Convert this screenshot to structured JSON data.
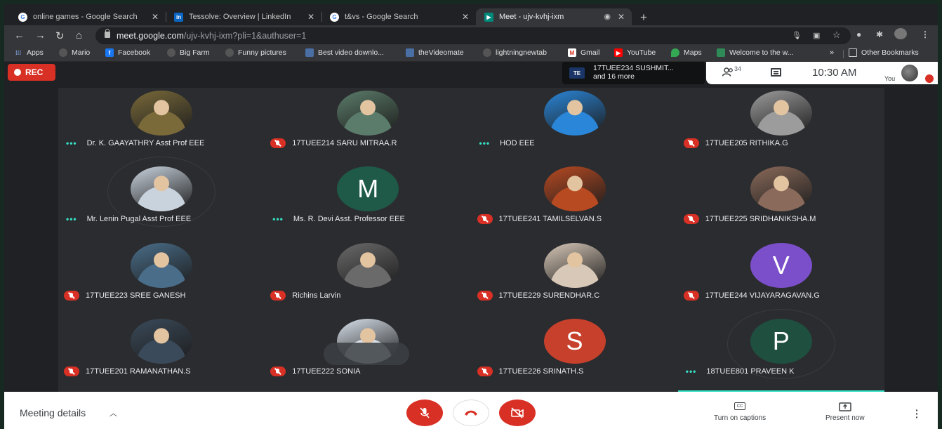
{
  "browser": {
    "tabs": [
      {
        "title": "online games - Google Search",
        "favicon": "google-icon",
        "active": false
      },
      {
        "title": "Tessolve: Overview | LinkedIn",
        "favicon": "linkedin-icon",
        "active": false
      },
      {
        "title": "t&vs - Google Search",
        "favicon": "google-icon",
        "active": false
      },
      {
        "title": "Meet - ujv-kvhj-ixm",
        "favicon": "meet-icon",
        "active": true
      }
    ],
    "url_host": "meet.google.com",
    "url_rest": "/ujv-kvhj-ixm?pli=1&authuser=1",
    "bookmarks": [
      {
        "label": "Apps",
        "icon": "apps-grid-icon"
      },
      {
        "label": "Mario",
        "icon": "globe-icon"
      },
      {
        "label": "Facebook",
        "icon": "facebook-icon"
      },
      {
        "label": "Big Farm",
        "icon": "globe-icon"
      },
      {
        "label": "Funny pictures",
        "icon": "globe-icon"
      },
      {
        "label": "Best video downlo...",
        "icon": "bookmark-icon"
      },
      {
        "label": "theVideomate",
        "icon": "bookmark-icon"
      },
      {
        "label": "lightningnewtab",
        "icon": "globe-icon"
      },
      {
        "label": "Gmail",
        "icon": "gmail-icon"
      },
      {
        "label": "YouTube",
        "icon": "youtube-icon"
      },
      {
        "label": "Maps",
        "icon": "maps-icon"
      },
      {
        "label": "Welcome to the w...",
        "icon": "bookmark-icon"
      }
    ],
    "bookmarks_more": "»",
    "other_bookmarks": "Other Bookmarks"
  },
  "meet": {
    "rec_label": "REC",
    "presenter_line1": "17TUEE234 SUSHMIT...",
    "presenter_line2": "and 16 more",
    "people_count": "34",
    "time": "10:30 AM",
    "you_label": "You",
    "participants": [
      {
        "name": "Dr. K. GAAYATHRY Asst Prof EEE",
        "muted": false,
        "avatar": "photo",
        "color": "#7a6a3a"
      },
      {
        "name": "17TUEE214 SARU MITRAA.R",
        "muted": true,
        "avatar": "photo",
        "color": "#5b7c6a"
      },
      {
        "name": "HOD EEE",
        "muted": false,
        "avatar": "photo",
        "color": "#2a86d8"
      },
      {
        "name": "17TUEE205 RITHIKA.G",
        "muted": true,
        "avatar": "photo",
        "color": "#9c9c9c"
      },
      {
        "name": "Mr. Lenin Pugal Asst Prof EEE",
        "muted": false,
        "avatar": "photo",
        "color": "#c9d3de"
      },
      {
        "name": "Ms. R. Devi Asst. Professor EEE",
        "muted": false,
        "avatar": "M",
        "color": "#1e5a47"
      },
      {
        "name": "17TUEE241 TAMILSELVAN.S",
        "muted": true,
        "avatar": "photo",
        "color": "#b84a22"
      },
      {
        "name": "17TUEE225 SRIDHANIKSHA.M",
        "muted": true,
        "avatar": "photo",
        "color": "#8a6a5a"
      },
      {
        "name": "17TUEE223 SREE GANESH",
        "muted": true,
        "avatar": "photo",
        "color": "#4a6e8a"
      },
      {
        "name": "Richins Larvin",
        "muted": true,
        "avatar": "photo",
        "color": "#6b6a6a"
      },
      {
        "name": "17TUEE229 SURENDHAR.C",
        "muted": true,
        "avatar": "photo",
        "color": "#d8c8b8"
      },
      {
        "name": "17TUEE244 VIJAYARAGAVAN.G",
        "muted": true,
        "avatar": "V",
        "color": "#7b4fc9"
      },
      {
        "name": "17TUEE201 RAMANATHAN.S",
        "muted": true,
        "avatar": "photo",
        "color": "#3a4a5a"
      },
      {
        "name": "17TUEE222 SONIA",
        "muted": true,
        "avatar": "photo",
        "color": "#d8e0ea"
      },
      {
        "name": "17TUEE226 SRINATH.S",
        "muted": true,
        "avatar": "S",
        "color": "#c7402c"
      },
      {
        "name": "18TUEE801 PRAVEEN K",
        "muted": false,
        "avatar": "P",
        "color": "#1f4f3f"
      }
    ]
  },
  "controls": {
    "meeting_details": "Meeting details",
    "captions_label": "Turn on captions",
    "present_label": "Present now",
    "captions_icon_text": "CC"
  }
}
